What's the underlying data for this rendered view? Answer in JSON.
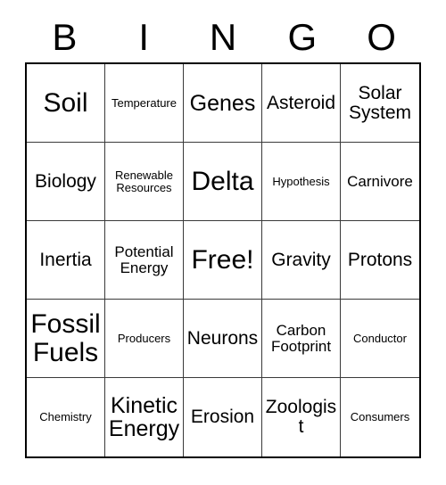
{
  "card": {
    "title": "BINGO",
    "header_letters": [
      "B",
      "I",
      "N",
      "G",
      "O"
    ],
    "colors": {
      "background": "#ffffff",
      "text": "#000000",
      "outer_border": "#000000",
      "inner_border": "#3a3a3a"
    },
    "grid": {
      "rows": 5,
      "columns": 5,
      "free_space_index": 12,
      "free_space_label": "Free!"
    },
    "cells": [
      {
        "label": "Soil",
        "size": "sz-xl",
        "column": "B",
        "row": 1
      },
      {
        "label": "Temperature",
        "size": "sz-xs",
        "column": "I",
        "row": 1
      },
      {
        "label": "Genes",
        "size": "sz-lg",
        "column": "N",
        "row": 1
      },
      {
        "label": "Asteroid",
        "size": "sz-md",
        "column": "G",
        "row": 1
      },
      {
        "label": "Solar System",
        "size": "sz-md",
        "column": "O",
        "row": 1
      },
      {
        "label": "Biology",
        "size": "sz-md",
        "column": "B",
        "row": 2
      },
      {
        "label": "Renewable Resources",
        "size": "sz-xs",
        "column": "I",
        "row": 2
      },
      {
        "label": "Delta",
        "size": "sz-xl",
        "column": "N",
        "row": 2
      },
      {
        "label": "Hypothesis",
        "size": "sz-xs",
        "column": "G",
        "row": 2
      },
      {
        "label": "Carnivore",
        "size": "sz-sm",
        "column": "O",
        "row": 2
      },
      {
        "label": "Inertia",
        "size": "sz-md",
        "column": "B",
        "row": 3
      },
      {
        "label": "Potential Energy",
        "size": "sz-sm",
        "column": "I",
        "row": 3
      },
      {
        "label": "Free!",
        "size": "sz-xl",
        "column": "N",
        "row": 3
      },
      {
        "label": "Gravity",
        "size": "sz-md",
        "column": "G",
        "row": 3
      },
      {
        "label": "Protons",
        "size": "sz-md",
        "column": "O",
        "row": 3
      },
      {
        "label": "Fossil Fuels",
        "size": "sz-xl",
        "column": "B",
        "row": 4
      },
      {
        "label": "Producers",
        "size": "sz-xs",
        "column": "I",
        "row": 4
      },
      {
        "label": "Neurons",
        "size": "sz-md",
        "column": "N",
        "row": 4
      },
      {
        "label": "Carbon Footprint",
        "size": "sz-sm",
        "column": "G",
        "row": 4
      },
      {
        "label": "Conductor",
        "size": "sz-xs",
        "column": "O",
        "row": 4
      },
      {
        "label": "Chemistry",
        "size": "sz-xs",
        "column": "B",
        "row": 5
      },
      {
        "label": "Kinetic Energy",
        "size": "sz-lg",
        "column": "I",
        "row": 5
      },
      {
        "label": "Erosion",
        "size": "sz-md",
        "column": "N",
        "row": 5
      },
      {
        "label": "Zoologist",
        "size": "sz-md",
        "column": "G",
        "row": 5
      },
      {
        "label": "Consumers",
        "size": "sz-xs",
        "column": "O",
        "row": 5
      }
    ]
  }
}
